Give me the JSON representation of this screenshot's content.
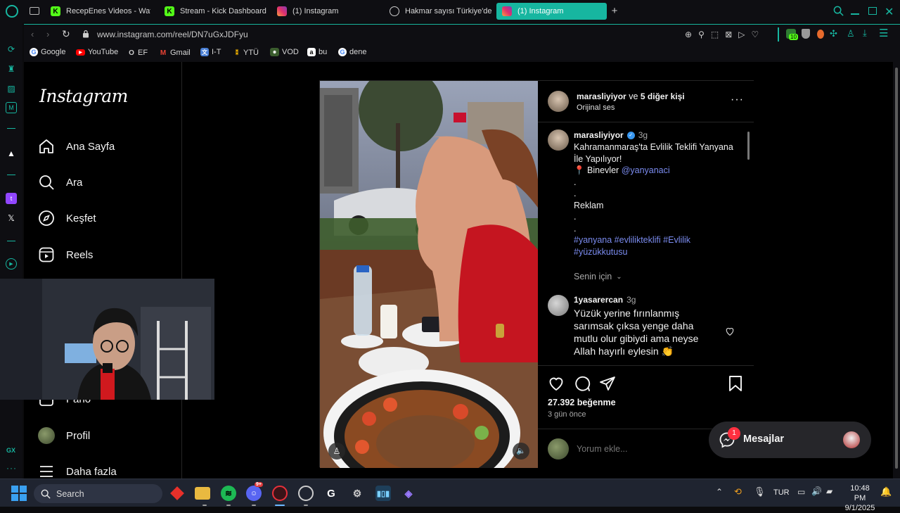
{
  "browser": {
    "tabs": [
      {
        "label": "RecepEnes Videos - Watc",
        "icon": "kick-icon",
        "active": false
      },
      {
        "label": "Stream - Kick Dashboard",
        "icon": "kick-icon",
        "active": false
      },
      {
        "label": "(1) Instagram",
        "icon": "instagram-icon",
        "active": false
      },
      {
        "label": "Hakmar sayısı Türkiye'de",
        "icon": "openai-icon",
        "active": false
      },
      {
        "label": "(1) Instagram",
        "icon": "instagram-icon",
        "active": true
      }
    ],
    "url": "www.instagram.com/reel/DN7uGxJDFyu",
    "bookmarks": [
      {
        "label": "Google",
        "icon": "google-icon"
      },
      {
        "label": "YouTube",
        "icon": "youtube-icon"
      },
      {
        "label": "EF",
        "icon": "ef-icon"
      },
      {
        "label": "Gmail",
        "icon": "gmail-icon"
      },
      {
        "label": "I-T",
        "icon": "translate-icon"
      },
      {
        "label": "YTÜ",
        "icon": "ytu-icon"
      },
      {
        "label": "VOD",
        "icon": "vod-icon"
      },
      {
        "label": "bu",
        "icon": "amazon-icon"
      },
      {
        "label": "dene",
        "icon": "google-icon"
      }
    ],
    "extension_badge": "10",
    "sidebar_label": "GX"
  },
  "instagram": {
    "logo": "Instagram",
    "nav": [
      {
        "label": "Ana Sayfa",
        "icon": "home-icon"
      },
      {
        "label": "Ara",
        "icon": "search-icon"
      },
      {
        "label": "Keşfet",
        "icon": "compass-icon"
      },
      {
        "label": "Reels",
        "icon": "reels-icon"
      },
      {
        "label": "Pano",
        "icon": "dashboard-icon"
      },
      {
        "label": "Profil",
        "icon": "avatar"
      },
      {
        "label": "Daha fazla",
        "icon": "menu-icon"
      }
    ],
    "post": {
      "header_user": "marasliyiyor",
      "header_connector": "ve",
      "header_others": "5 diğer kişi",
      "audio": "Orijinal ses",
      "caption_user": "marasliyiyor",
      "caption_time": "3g",
      "caption_lines": [
        "Kahramanmaraş'ta Evlilik Teklifi Yanyana",
        "İle Yapılıyor!"
      ],
      "location_prefix": "📍 Binevler",
      "location_mention": "@yanyanaci",
      "dots": ".",
      "ad_label": "Reklam",
      "hashtags_line1": "#yanyana #evlilikteklifi #Evlilik",
      "hashtags_line2": "#yüzükkutusu",
      "for_you": "Senin için",
      "comment": {
        "user": "1yasarercan",
        "time": "3g",
        "lines": [
          "Yüzük yerine fırınlanmış",
          "sarımsak çıksa yenge daha",
          "mutlu olur gibiydi ama neyse",
          "Allah hayırlı eylesin 👏"
        ]
      },
      "likes": "27.392 beğenme",
      "posted": "3 gün önce",
      "comment_placeholder": "Yorum ekle..."
    },
    "messages": {
      "label": "Mesajlar",
      "badge": "1"
    }
  },
  "taskbar": {
    "search_label": "Search",
    "language": "TUR",
    "time": "10:48 PM",
    "date": "9/1/2025",
    "discord_badge": "9+"
  },
  "colors": {
    "accent": "#17b6a0",
    "link": "#7b8cf0",
    "ig_badge": "#ff3040"
  }
}
